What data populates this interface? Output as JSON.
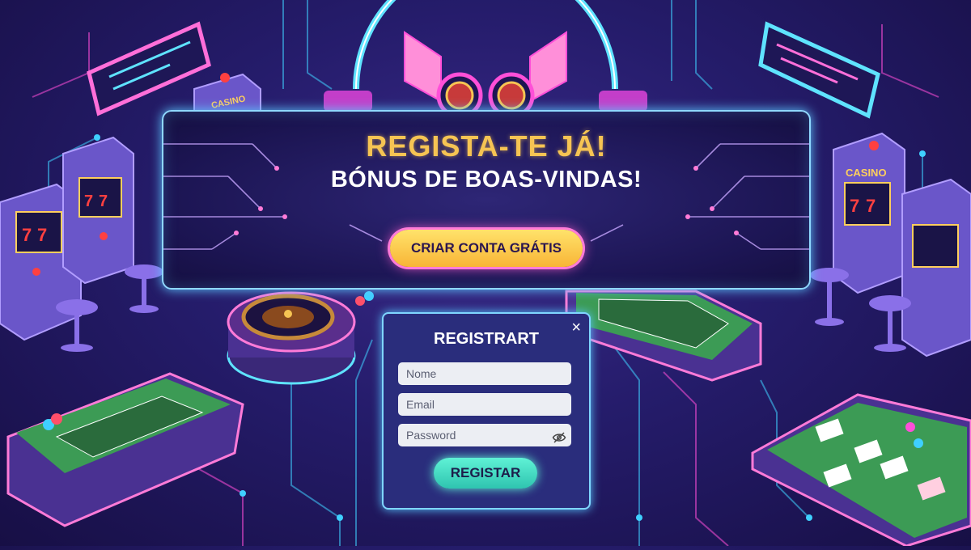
{
  "banner": {
    "title": "REGISTA-TE JÁ!",
    "subtitle": "BÓNUS DE BOAS-VINDAS!",
    "cta_label": "CRIAR CONTA GRÁTIS"
  },
  "machines": {
    "left_sign": "CASINO",
    "right_sign": "CASINO",
    "reel_symbol": "7"
  },
  "modal": {
    "title": "REGISTRART",
    "close_glyph": "×",
    "name_placeholder": "Nome",
    "email_placeholder": "Email",
    "password_placeholder": "Password",
    "submit_label": "REGISTAR"
  },
  "colors": {
    "accent_gold": "#f6c453",
    "neon_blue": "#3fd0ff",
    "neon_pink": "#ff4fd8",
    "submit_teal": "#5ff2d6",
    "felt_green": "#3c9b55"
  }
}
